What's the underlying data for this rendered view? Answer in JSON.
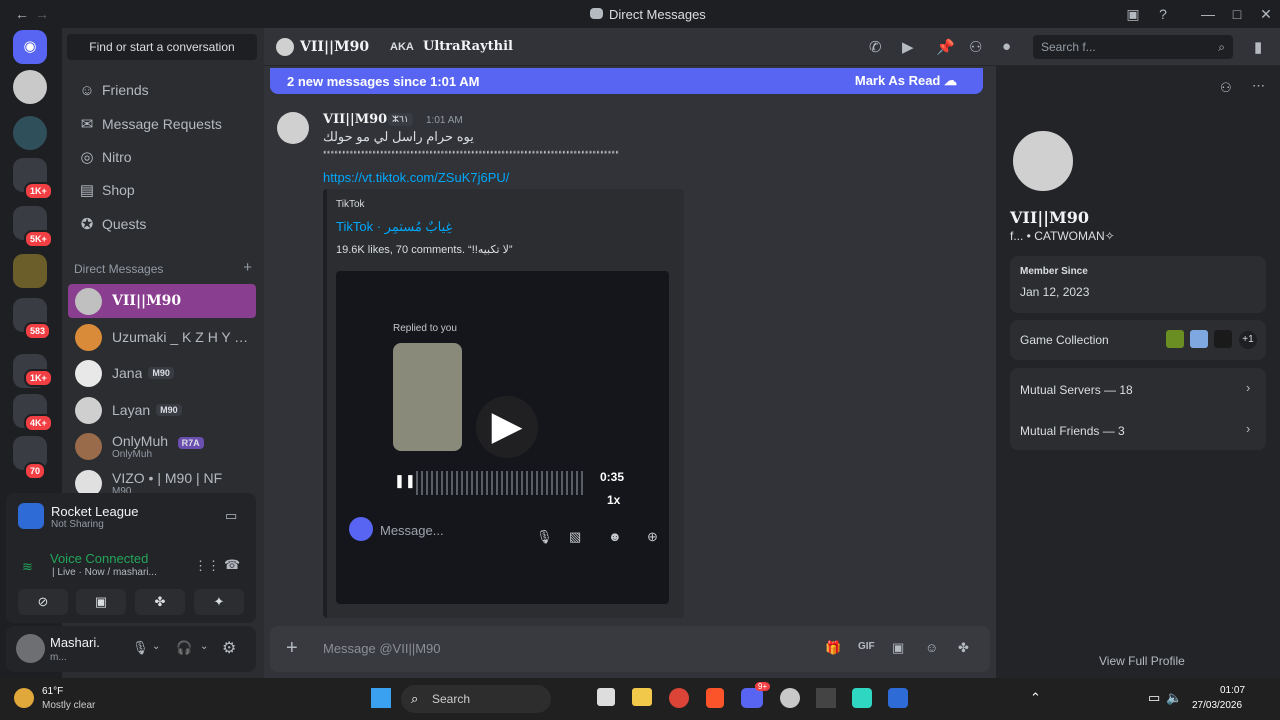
{
  "window": {
    "title": "Direct Messages"
  },
  "guild_badges": [
    "1K+",
    "5K+",
    "583",
    "1K+",
    "4K+",
    "70"
  ],
  "sidebar": {
    "search": "Find or start a conversation",
    "nav": [
      "Friends",
      "Message Requests",
      "Nitro",
      "Shop",
      "Quests"
    ],
    "dm_header": "Direct Messages",
    "dms": [
      {
        "name": "VII||M90",
        "tag": "",
        "sub": ""
      },
      {
        "name": "Uzumaki _ K Z H Y T ...",
        "tag": "",
        "sub": ""
      },
      {
        "name": "Jana",
        "tag": "M90",
        "sub": ""
      },
      {
        "name": "Layan",
        "tag": "M90",
        "sub": ""
      },
      {
        "name": "OnlyMuh",
        "tag": "R7A",
        "sub": "OnlyMuh"
      },
      {
        "name": "VIZO • | M90 | NF",
        "tag": "",
        "sub": "M90"
      }
    ]
  },
  "activity": {
    "game": "Rocket League",
    "game_status": "Not Sharing",
    "voice": "Voice Connected",
    "voice_sub": "| Live · Now / mashari..."
  },
  "user": {
    "name": "Mashari.",
    "status": "m..."
  },
  "header": {
    "name": "VII||M90",
    "aka": "AKA",
    "aka_name": "UltraRaythil",
    "search": "Search f..."
  },
  "banner": {
    "text": "2 new messages since 1:01 AM",
    "action": "Mark As Read"
  },
  "message": {
    "author": "VII||M90",
    "tag": "ⵣ٦١",
    "time": "1:01 AM",
    "line1": "يوه حرام راسل لي مو حولك",
    "line2": "ٴٴٴٴٴٴٴٴٴٴٴٴٴٴٴٴٴٴٴٴٴٴٴٴٴٴٴٴٴٴٴٴٴٴٴٴٴٴٴٴٴٴٴٴٴٴٴٴٴٴٴٴٴٴٴٴٴٴٴٴٴٴٴٴٴٴٴٴٴٴٴٴٴٴٴٴٴٴ",
    "link": "https://vt.tiktok.com/ZSuK7j6PU/"
  },
  "embed": {
    "provider": "TikTok",
    "title": "TikTok · غِيابٌ مُستمِر",
    "desc": "19.6K likes, 70 comments. “!!لا تكبيه”",
    "replied": "Replied to you",
    "time": "0:35",
    "speed": "1x",
    "input": "Message..."
  },
  "composer": {
    "placeholder": "Message @VII||M90"
  },
  "profile": {
    "name": "VII||M90",
    "sub": "f... • CATWOMAN✧",
    "member_label": "Member Since",
    "member_date": "Jan 12, 2023",
    "games": "Game Collection",
    "games_more": "+1",
    "servers": "Mutual Servers — 18",
    "friends": "Mutual Friends — 3",
    "view": "View Full Profile"
  },
  "taskbar": {
    "weather": "61°F",
    "weather_sub": "Mostly clear",
    "search": "Search",
    "time": "01:07",
    "date": "27/03/2026",
    "badge": "9+"
  }
}
